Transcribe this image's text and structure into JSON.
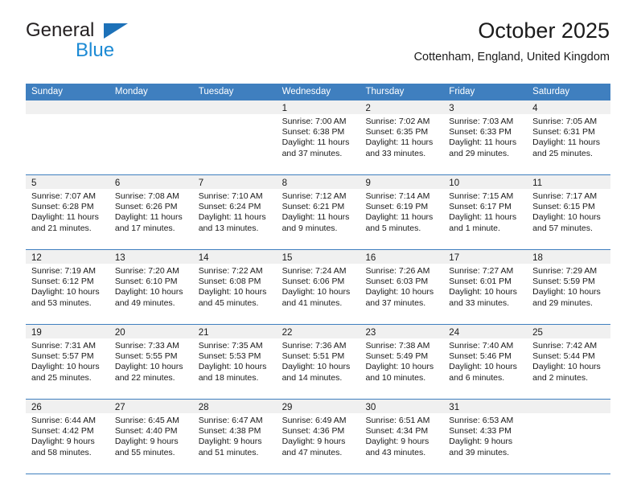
{
  "brand": {
    "name_part1": "General",
    "name_part2": "Blue",
    "triangle_color": "#1d71b8",
    "blue_color": "#1c8ad4"
  },
  "header": {
    "title": "October 2025",
    "subtitle": "Cottenham, England, United Kingdom"
  },
  "theme": {
    "header_row_color": "#3f7fbf",
    "day_band_color": "#f0f0f0",
    "grid_line_color": "#3f7fbf"
  },
  "weekdays": [
    "Sunday",
    "Monday",
    "Tuesday",
    "Wednesday",
    "Thursday",
    "Friday",
    "Saturday"
  ],
  "weeks": [
    [
      {
        "day": "",
        "sunrise": "",
        "sunset": "",
        "daylight_line1": "",
        "daylight_line2": ""
      },
      {
        "day": "",
        "sunrise": "",
        "sunset": "",
        "daylight_line1": "",
        "daylight_line2": ""
      },
      {
        "day": "",
        "sunrise": "",
        "sunset": "",
        "daylight_line1": "",
        "daylight_line2": ""
      },
      {
        "day": "1",
        "sunrise": "Sunrise: 7:00 AM",
        "sunset": "Sunset: 6:38 PM",
        "daylight_line1": "Daylight: 11 hours",
        "daylight_line2": "and 37 minutes."
      },
      {
        "day": "2",
        "sunrise": "Sunrise: 7:02 AM",
        "sunset": "Sunset: 6:35 PM",
        "daylight_line1": "Daylight: 11 hours",
        "daylight_line2": "and 33 minutes."
      },
      {
        "day": "3",
        "sunrise": "Sunrise: 7:03 AM",
        "sunset": "Sunset: 6:33 PM",
        "daylight_line1": "Daylight: 11 hours",
        "daylight_line2": "and 29 minutes."
      },
      {
        "day": "4",
        "sunrise": "Sunrise: 7:05 AM",
        "sunset": "Sunset: 6:31 PM",
        "daylight_line1": "Daylight: 11 hours",
        "daylight_line2": "and 25 minutes."
      }
    ],
    [
      {
        "day": "5",
        "sunrise": "Sunrise: 7:07 AM",
        "sunset": "Sunset: 6:28 PM",
        "daylight_line1": "Daylight: 11 hours",
        "daylight_line2": "and 21 minutes."
      },
      {
        "day": "6",
        "sunrise": "Sunrise: 7:08 AM",
        "sunset": "Sunset: 6:26 PM",
        "daylight_line1": "Daylight: 11 hours",
        "daylight_line2": "and 17 minutes."
      },
      {
        "day": "7",
        "sunrise": "Sunrise: 7:10 AM",
        "sunset": "Sunset: 6:24 PM",
        "daylight_line1": "Daylight: 11 hours",
        "daylight_line2": "and 13 minutes."
      },
      {
        "day": "8",
        "sunrise": "Sunrise: 7:12 AM",
        "sunset": "Sunset: 6:21 PM",
        "daylight_line1": "Daylight: 11 hours",
        "daylight_line2": "and 9 minutes."
      },
      {
        "day": "9",
        "sunrise": "Sunrise: 7:14 AM",
        "sunset": "Sunset: 6:19 PM",
        "daylight_line1": "Daylight: 11 hours",
        "daylight_line2": "and 5 minutes."
      },
      {
        "day": "10",
        "sunrise": "Sunrise: 7:15 AM",
        "sunset": "Sunset: 6:17 PM",
        "daylight_line1": "Daylight: 11 hours",
        "daylight_line2": "and 1 minute."
      },
      {
        "day": "11",
        "sunrise": "Sunrise: 7:17 AM",
        "sunset": "Sunset: 6:15 PM",
        "daylight_line1": "Daylight: 10 hours",
        "daylight_line2": "and 57 minutes."
      }
    ],
    [
      {
        "day": "12",
        "sunrise": "Sunrise: 7:19 AM",
        "sunset": "Sunset: 6:12 PM",
        "daylight_line1": "Daylight: 10 hours",
        "daylight_line2": "and 53 minutes."
      },
      {
        "day": "13",
        "sunrise": "Sunrise: 7:20 AM",
        "sunset": "Sunset: 6:10 PM",
        "daylight_line1": "Daylight: 10 hours",
        "daylight_line2": "and 49 minutes."
      },
      {
        "day": "14",
        "sunrise": "Sunrise: 7:22 AM",
        "sunset": "Sunset: 6:08 PM",
        "daylight_line1": "Daylight: 10 hours",
        "daylight_line2": "and 45 minutes."
      },
      {
        "day": "15",
        "sunrise": "Sunrise: 7:24 AM",
        "sunset": "Sunset: 6:06 PM",
        "daylight_line1": "Daylight: 10 hours",
        "daylight_line2": "and 41 minutes."
      },
      {
        "day": "16",
        "sunrise": "Sunrise: 7:26 AM",
        "sunset": "Sunset: 6:03 PM",
        "daylight_line1": "Daylight: 10 hours",
        "daylight_line2": "and 37 minutes."
      },
      {
        "day": "17",
        "sunrise": "Sunrise: 7:27 AM",
        "sunset": "Sunset: 6:01 PM",
        "daylight_line1": "Daylight: 10 hours",
        "daylight_line2": "and 33 minutes."
      },
      {
        "day": "18",
        "sunrise": "Sunrise: 7:29 AM",
        "sunset": "Sunset: 5:59 PM",
        "daylight_line1": "Daylight: 10 hours",
        "daylight_line2": "and 29 minutes."
      }
    ],
    [
      {
        "day": "19",
        "sunrise": "Sunrise: 7:31 AM",
        "sunset": "Sunset: 5:57 PM",
        "daylight_line1": "Daylight: 10 hours",
        "daylight_line2": "and 25 minutes."
      },
      {
        "day": "20",
        "sunrise": "Sunrise: 7:33 AM",
        "sunset": "Sunset: 5:55 PM",
        "daylight_line1": "Daylight: 10 hours",
        "daylight_line2": "and 22 minutes."
      },
      {
        "day": "21",
        "sunrise": "Sunrise: 7:35 AM",
        "sunset": "Sunset: 5:53 PM",
        "daylight_line1": "Daylight: 10 hours",
        "daylight_line2": "and 18 minutes."
      },
      {
        "day": "22",
        "sunrise": "Sunrise: 7:36 AM",
        "sunset": "Sunset: 5:51 PM",
        "daylight_line1": "Daylight: 10 hours",
        "daylight_line2": "and 14 minutes."
      },
      {
        "day": "23",
        "sunrise": "Sunrise: 7:38 AM",
        "sunset": "Sunset: 5:49 PM",
        "daylight_line1": "Daylight: 10 hours",
        "daylight_line2": "and 10 minutes."
      },
      {
        "day": "24",
        "sunrise": "Sunrise: 7:40 AM",
        "sunset": "Sunset: 5:46 PM",
        "daylight_line1": "Daylight: 10 hours",
        "daylight_line2": "and 6 minutes."
      },
      {
        "day": "25",
        "sunrise": "Sunrise: 7:42 AM",
        "sunset": "Sunset: 5:44 PM",
        "daylight_line1": "Daylight: 10 hours",
        "daylight_line2": "and 2 minutes."
      }
    ],
    [
      {
        "day": "26",
        "sunrise": "Sunrise: 6:44 AM",
        "sunset": "Sunset: 4:42 PM",
        "daylight_line1": "Daylight: 9 hours",
        "daylight_line2": "and 58 minutes."
      },
      {
        "day": "27",
        "sunrise": "Sunrise: 6:45 AM",
        "sunset": "Sunset: 4:40 PM",
        "daylight_line1": "Daylight: 9 hours",
        "daylight_line2": "and 55 minutes."
      },
      {
        "day": "28",
        "sunrise": "Sunrise: 6:47 AM",
        "sunset": "Sunset: 4:38 PM",
        "daylight_line1": "Daylight: 9 hours",
        "daylight_line2": "and 51 minutes."
      },
      {
        "day": "29",
        "sunrise": "Sunrise: 6:49 AM",
        "sunset": "Sunset: 4:36 PM",
        "daylight_line1": "Daylight: 9 hours",
        "daylight_line2": "and 47 minutes."
      },
      {
        "day": "30",
        "sunrise": "Sunrise: 6:51 AM",
        "sunset": "Sunset: 4:34 PM",
        "daylight_line1": "Daylight: 9 hours",
        "daylight_line2": "and 43 minutes."
      },
      {
        "day": "31",
        "sunrise": "Sunrise: 6:53 AM",
        "sunset": "Sunset: 4:33 PM",
        "daylight_line1": "Daylight: 9 hours",
        "daylight_line2": "and 39 minutes."
      },
      {
        "day": "",
        "sunrise": "",
        "sunset": "",
        "daylight_line1": "",
        "daylight_line2": ""
      }
    ]
  ]
}
